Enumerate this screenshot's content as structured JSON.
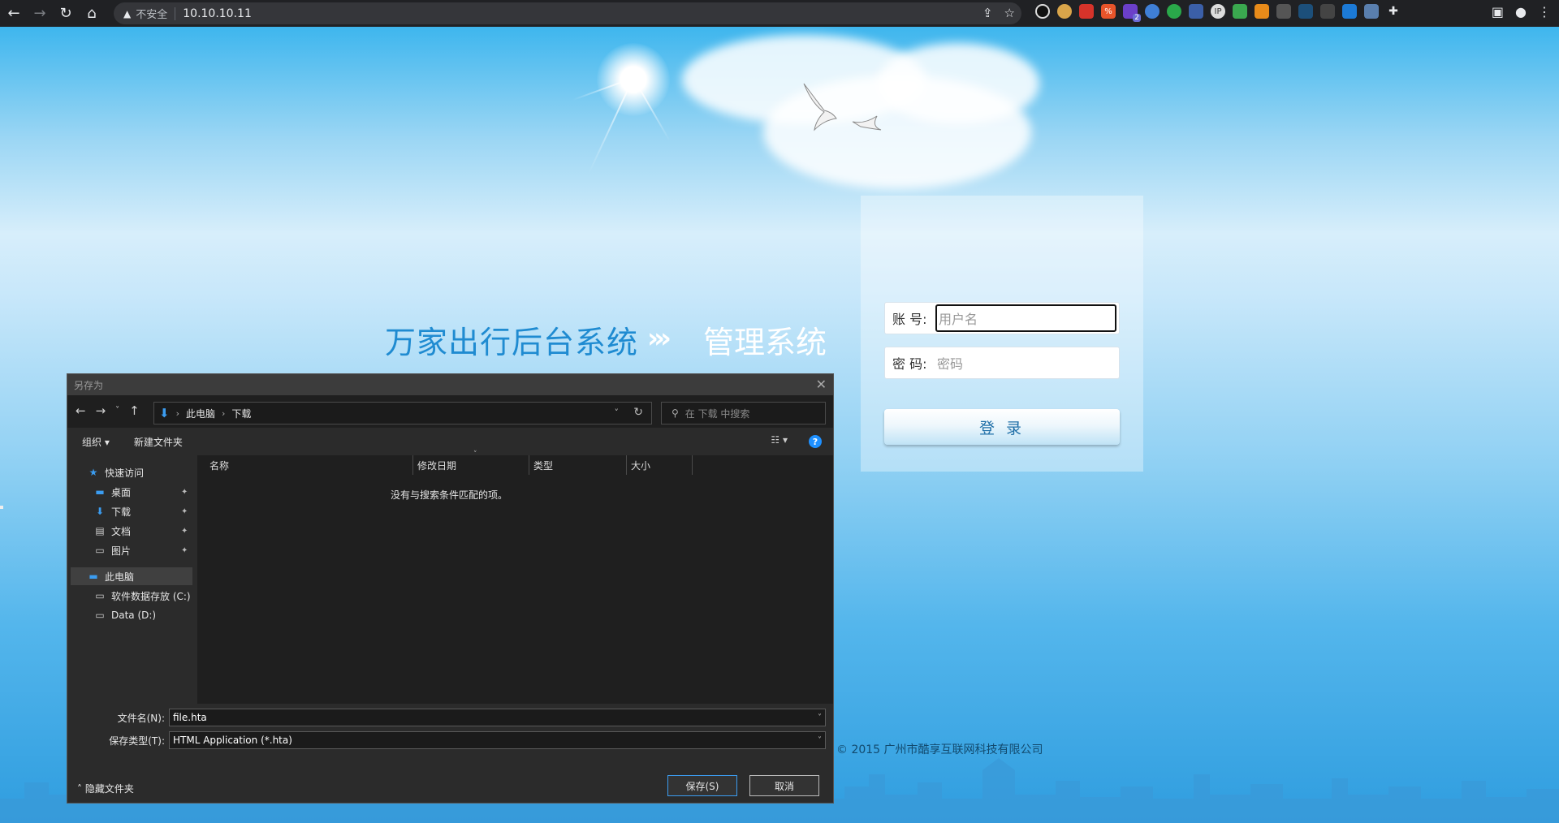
{
  "browser": {
    "insecure_label": "不安全",
    "url": "10.10.10.11",
    "extension_badge": "2"
  },
  "page": {
    "system_title": "万家出行后台系统",
    "system_arrows": "›››",
    "system_subtitle": "管理系统",
    "account_label": "账 号:",
    "account_placeholder": "用户名",
    "password_label": "密 码:",
    "password_placeholder": "密码",
    "login_button": "登 录",
    "copyright": "© 2015 广州市酷享互联网科技有限公司"
  },
  "dialog": {
    "title": "另存为",
    "breadcrumb": [
      "此电脑",
      "下载"
    ],
    "search_placeholder": "在 下载 中搜索",
    "organize": "组织 ▾",
    "new_folder": "新建文件夹",
    "help": "?",
    "nav": {
      "quick_access": "快速访问",
      "desktop": "桌面",
      "downloads": "下载",
      "documents": "文档",
      "pictures": "图片",
      "this_pc": "此电脑",
      "drive_c": "软件数据存放 (C:)",
      "drive_d": "Data (D:)"
    },
    "columns": [
      "名称",
      "修改日期",
      "类型",
      "大小"
    ],
    "empty_message": "没有与搜索条件匹配的项。",
    "filename_label": "文件名(N):",
    "filename_value": "file.hta",
    "filetype_label": "保存类型(T):",
    "filetype_value": "HTML Application (*.hta)",
    "hide_folders": "隐藏文件夹",
    "save_button": "保存(S)",
    "cancel_button": "取消"
  }
}
